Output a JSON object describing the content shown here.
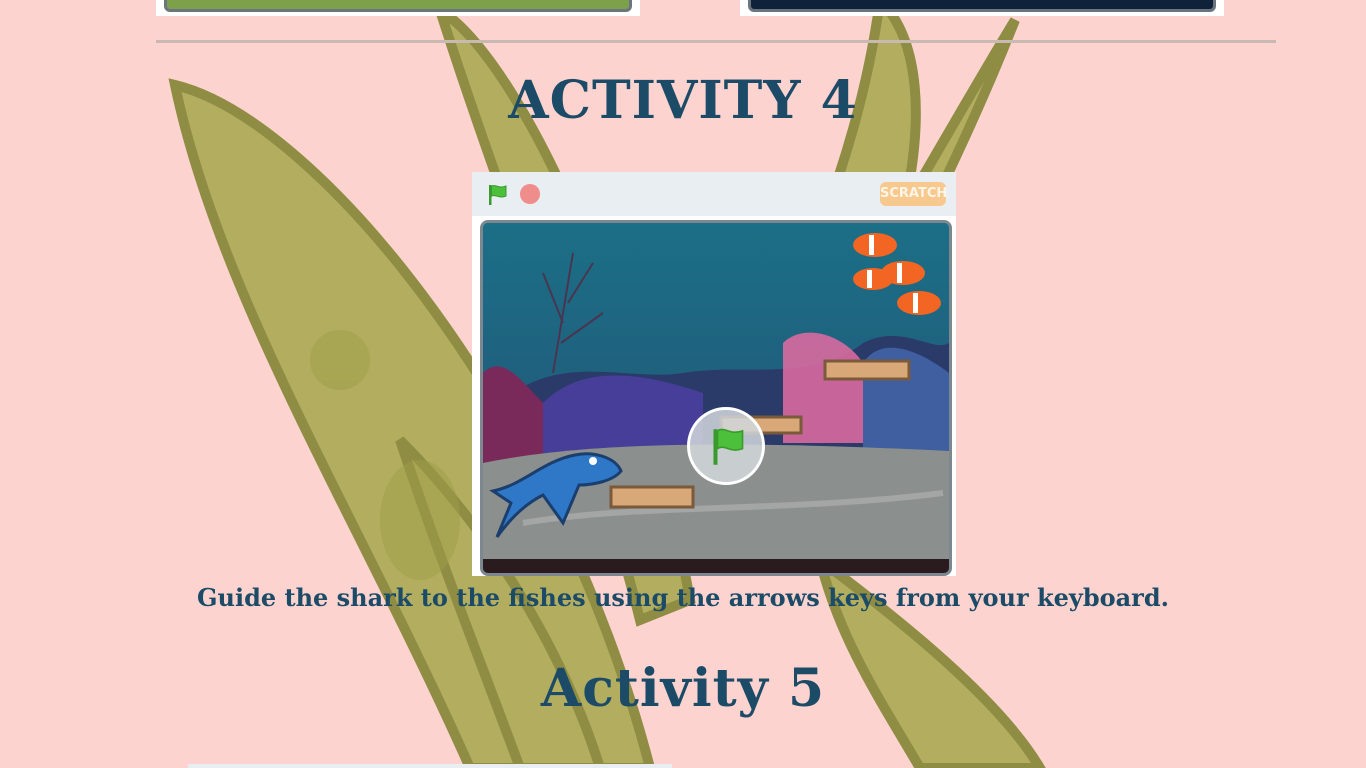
{
  "activity4": {
    "title": "ACTIVITY 4",
    "instruction": "Guide the shark to the fishes using the arrows keys from your keyboard.",
    "player": {
      "logo_text": "SCRATCH"
    }
  },
  "activity5": {
    "title": "Activity 5"
  },
  "colors": {
    "heading": "#1c4b68",
    "page_background": "#fdd3cf",
    "green_flag": "#4cbf3b",
    "stop": "#ef8c8c",
    "shark": "#2f78c8",
    "clownfish": "#f26522"
  },
  "icons": {
    "flag": "green-flag-icon",
    "stop": "stop-icon"
  }
}
